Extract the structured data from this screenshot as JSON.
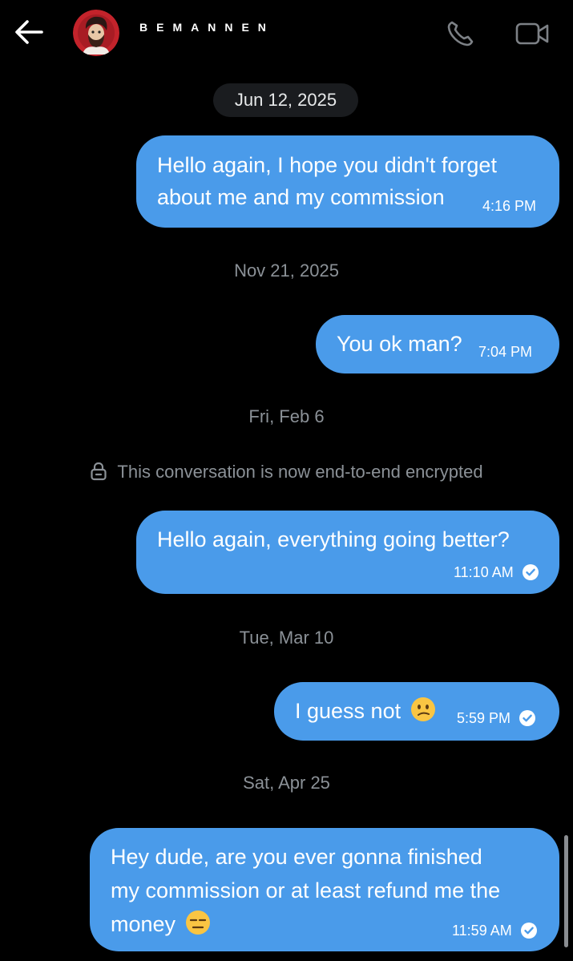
{
  "header": {
    "contact_name": "BEMANNEN",
    "back_icon": "arrow-left-icon",
    "call_icon": "phone-icon",
    "video_icon": "video-camera-icon"
  },
  "colors": {
    "background": "#000000",
    "bubble": "#4a9bea",
    "date_pill": "#1a1c1f",
    "muted_text": "#8b9197"
  },
  "conversation": {
    "date_pill": "Jun 12, 2025",
    "encryption_notice": "This conversation is now end-to-end encrypted",
    "separators": [
      "Nov 21, 2025",
      "Fri, Feb 6",
      "Tue, Mar 10",
      "Sat, Apr 25"
    ],
    "messages": [
      {
        "lines": [
          "Hello again, I hope you didn't forget",
          "about me and my commission"
        ],
        "time": "4:16 PM",
        "read": false
      },
      {
        "lines": [
          "You ok man?"
        ],
        "time": "7:04 PM",
        "read": false
      },
      {
        "lines": [
          "Hello again, everything going better?"
        ],
        "time": "11:10 AM",
        "read": true
      },
      {
        "lines": [
          "I guess not"
        ],
        "emoji": "confused-face",
        "time": "5:59 PM",
        "read": true
      },
      {
        "lines": [
          "Hey dude, are you ever gonna finished",
          "my commission or at least refund me the",
          "money"
        ],
        "emoji": "expressionless-face",
        "time": "11:59 AM",
        "read": true
      }
    ]
  }
}
